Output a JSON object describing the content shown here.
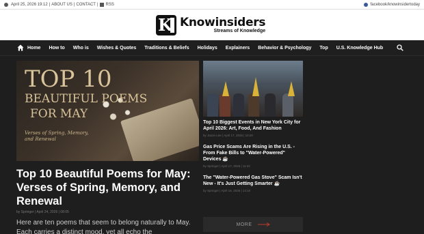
{
  "topbar": {
    "date": "April 25, 2026 19:12",
    "about": "ABOUT US",
    "contact": "CONTACT",
    "rss": "RSS",
    "facebook": "facebook/knowinsidertoday"
  },
  "logo": {
    "name": "Knowinsiders",
    "tagline": "Streams of Knowledge"
  },
  "nav": {
    "items": [
      "Home",
      "How to",
      "Who is",
      "Wishes & Quotes",
      "Traditions & Beliefs",
      "Holidays",
      "Explainers",
      "Behavior & Psychology",
      "Top",
      "U.S. Knowledge Hub"
    ]
  },
  "hero": {
    "image_text": {
      "line1": "TOP 10",
      "line2": "BEAUTIFUL POEMS",
      "line3": "FOR MAY",
      "line4": "Verses of Spring, Memory, and Renewal"
    },
    "title": "Top 10 Beautiful Poems for May: Verses of Spring, Memory, and Renewal",
    "meta": "by Springer | April 24, 2026 | 08:05",
    "excerpt": "Here are ten poems that seem to belong naturally to May. Each carries a distinct mood, yet all echo the"
  },
  "side": {
    "items": [
      {
        "title": "Top 10 Biggest Events in New York City for April 2026: Art, Food, And Fashion",
        "meta": "by Jason Lee | April 17, 2026 | 10:20"
      },
      {
        "title": "Gas Price Scams Are Rising in the U.S. - From Fake Bills to \"Water-Powered\" Devices ☕",
        "meta": "by Springer | April 17, 2026 | 11:32"
      },
      {
        "title": "The \"Water-Powered Gas Stove\" Scam Isn't New - It's Just Getting Smarter ☕",
        "meta": "by Springer | April 16, 2026 | 14:10"
      }
    ],
    "more_label": "MORE"
  },
  "colors": {
    "page_bg": "#1e1e1e",
    "accent": "#c0392b",
    "gold": "#d8c39a"
  }
}
